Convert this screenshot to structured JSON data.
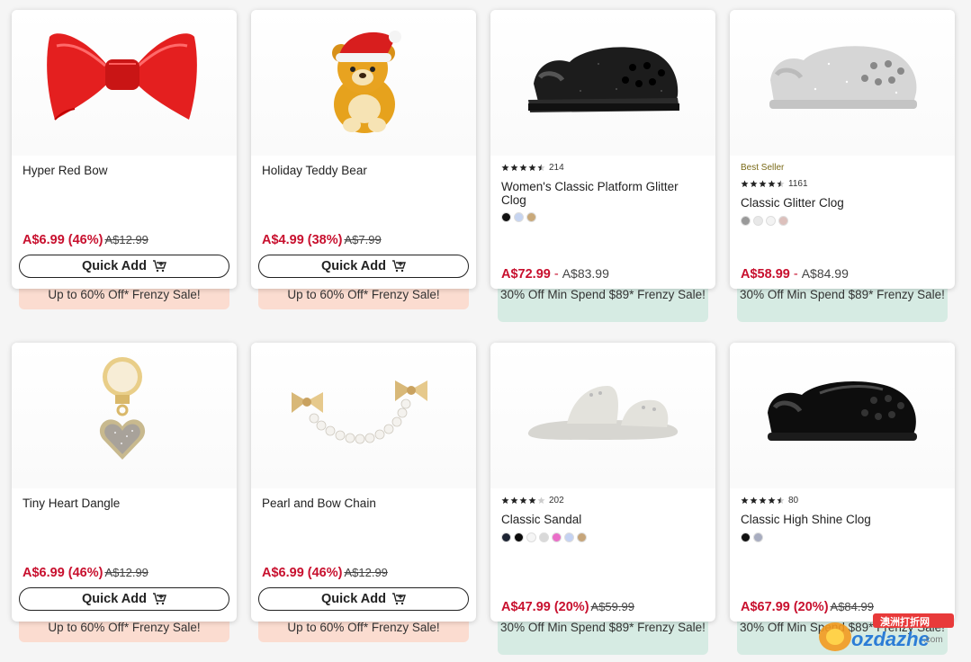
{
  "products": [
    {
      "name": "Hyper Red Bow",
      "sale": "A$6.99 (46%)",
      "orig": "A$12.99",
      "quick_add": "Quick Add",
      "promo": "Up to 60% Off* Frenzy Sale!"
    },
    {
      "name": "Holiday Teddy Bear",
      "sale": "A$4.99 (38%)",
      "orig": "A$7.99",
      "quick_add": "Quick Add",
      "promo": "Up to 60% Off* Frenzy Sale!"
    },
    {
      "name": "Women's Classic Platform Glitter Clog",
      "rating": 4.5,
      "reviews": "214",
      "sale": "A$72.99",
      "sep": " - ",
      "max": "A$83.99",
      "promo": "30% Off Min Spend $89* Frenzy Sale!",
      "swatches": [
        "#111111",
        "#c6d4f0",
        "#c9a97a"
      ]
    },
    {
      "badge": "Best Seller",
      "name": "Classic Glitter Clog",
      "rating": 4.5,
      "reviews": "1161",
      "sale": "A$58.99",
      "sep": " - ",
      "max": "A$84.99",
      "promo": "30% Off Min Spend $89* Frenzy Sale!",
      "swatches": [
        "#999999",
        "#e8e8e8",
        "#f3f3f3",
        "#dcc0bc"
      ]
    },
    {
      "name": "Tiny Heart Dangle",
      "sale": "A$6.99 (46%)",
      "orig": "A$12.99",
      "quick_add": "Quick Add",
      "promo": "Up to 60% Off* Frenzy Sale!"
    },
    {
      "name": "Pearl and Bow Chain",
      "sale": "A$6.99 (46%)",
      "orig": "A$12.99",
      "quick_add": "Quick Add",
      "promo": "Up to 60% Off* Frenzy Sale!"
    },
    {
      "name": "Classic Sandal",
      "rating": 4,
      "reviews": "202",
      "sale": "A$47.99 (20%)",
      "orig": "A$59.99",
      "promo": "30% Off Min Spend $89* Frenzy Sale!",
      "swatches": [
        "#1d2433",
        "#0b0b0b",
        "#f5f5f5",
        "#d9d9d9",
        "#ea6ec8",
        "#c4d2f2",
        "#c6a57a"
      ]
    },
    {
      "name": "Classic High Shine Clog",
      "rating": 4.5,
      "reviews": "80",
      "sale": "A$67.99 (20%)",
      "orig": "A$84.99",
      "promo": "30% Off Min Spend $89* Frenzy Sale!",
      "swatches": [
        "#111111",
        "#a8adc0"
      ]
    }
  ],
  "colors": {
    "sale": "#c8102e",
    "promo_pink": "#fbdcd0",
    "promo_mint": "#d6ebe3",
    "badge": "#7a6a18"
  },
  "watermark": {
    "cn": "澳洲打折网",
    "en": "ozdazhe",
    "tld": ".com"
  }
}
